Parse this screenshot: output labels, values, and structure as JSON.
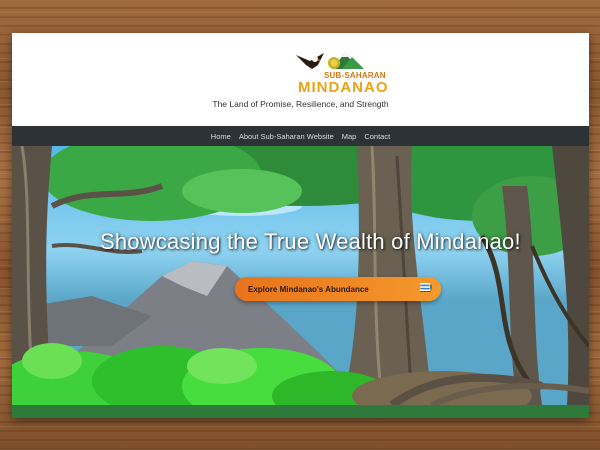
{
  "brand": {
    "name_top": "SUB-SAHARAN",
    "name_main": "MINDANAO",
    "tagline": "The Land of Promise, Resilience, and Strength"
  },
  "nav": {
    "items": [
      {
        "label": "Home"
      },
      {
        "label": "About Sub-Saharan Website"
      },
      {
        "label": "Map"
      },
      {
        "label": "Contact"
      }
    ]
  },
  "hero": {
    "title": "Showcasing the True Wealth of Mindanao!",
    "cta_label": "Explore Mindanao's Abundance",
    "cta_icons": [
      "mountain-icon",
      "fish-icon",
      "menu-icon"
    ]
  },
  "colors": {
    "nav_bg": "#2d3236",
    "cta_orange": "#f08a25",
    "footer_green": "#2e7a3a"
  }
}
